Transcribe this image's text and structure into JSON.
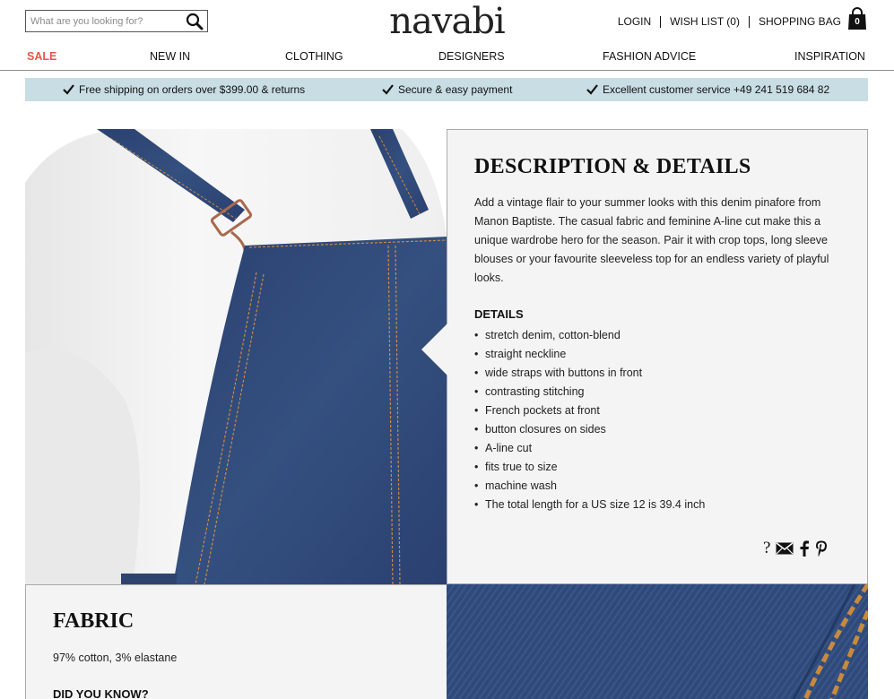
{
  "search": {
    "placeholder": "What are you looking for?"
  },
  "brand": {
    "logo": "navabi"
  },
  "account": {
    "login": "LOGIN",
    "wishlist": "WISH LIST (0)",
    "bag_label": "SHOPPING BAG",
    "bag_count": "0"
  },
  "nav": {
    "sale": "SALE",
    "new_in": "NEW IN",
    "clothing": "CLOTHING",
    "designers": "DESIGNERS",
    "fashion_advice": "FASHION ADVICE",
    "inspiration": "INSPIRATION"
  },
  "usp": {
    "shipping": "Free shipping on orders over $399.00 & returns",
    "payment": "Secure & easy payment",
    "service": "Excellent customer service +49 241 519 684 82"
  },
  "description": {
    "title": "DESCRIPTION & DETAILS",
    "text": "Add a vintage flair to your summer looks with this denim pinafore from Manon Baptiste. The casual fabric and feminine A-line cut make this a unique wardrobe hero for the season. Pair it with crop tops, long sleeve blouses or your favourite sleeveless top for an endless variety of playful looks.",
    "details_heading": "DETAILS",
    "details": [
      "stretch denim, cotton-blend",
      "straight neckline",
      "wide straps with buttons in front",
      "contrasting stitching",
      "French pockets at front",
      "button closures on sides",
      "A-line cut",
      "fits true to size",
      "machine wash",
      "The total length for a US size 12 is 39.4 inch"
    ],
    "share_question": "?"
  },
  "fabric": {
    "title": "FABRIC",
    "composition": "97% cotton, 3% elastane",
    "did_you_know": "DID YOU KNOW?"
  },
  "colors": {
    "sale": "#e8554e",
    "usp_bar": "#c9dde4",
    "panel": "#f4f4f4",
    "denim": "#2f4a7a"
  }
}
